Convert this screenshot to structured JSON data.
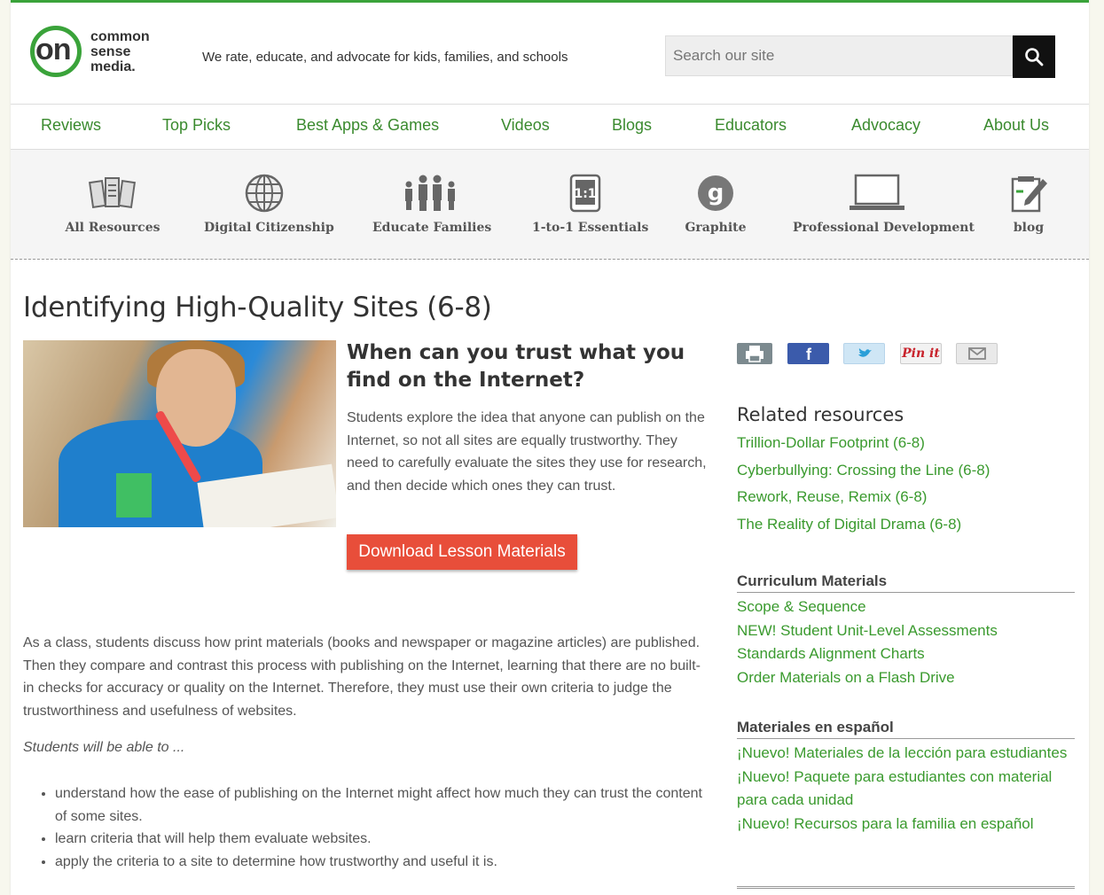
{
  "brand": {
    "logo_on": "on",
    "logo_lines": [
      "common",
      "sense",
      "media."
    ],
    "tagline": "We rate, educate, and advocate for kids, families, and schools"
  },
  "search": {
    "placeholder": "Search our site"
  },
  "main_nav": [
    "Reviews",
    "Top Picks",
    "Best Apps & Games",
    "Videos",
    "Blogs",
    "Educators",
    "Advocacy",
    "About Us"
  ],
  "sub_nav": [
    {
      "label": "All Resources",
      "icon": "stacked-papers-icon"
    },
    {
      "label": "Digital Citizenship",
      "icon": "globe-icon"
    },
    {
      "label": "Educate Families",
      "icon": "family-icon"
    },
    {
      "label": "1-to-1 Essentials",
      "icon": "one-to-one-icon"
    },
    {
      "label": "Graphite",
      "icon": "graphite-g-icon"
    },
    {
      "label": "Professional Development",
      "icon": "laptop-icon"
    },
    {
      "label": "blog",
      "icon": "notepad-pencil-icon"
    }
  ],
  "lesson": {
    "title": "Identifying High-Quality Sites (6-8)",
    "question": "When can you trust what you find on the Internet?",
    "description": "Students explore the idea that anyone can publish on the Internet, so not all sites are equally trustworthy. They need to carefully evaluate the sites they use for research, and then decide which ones they can trust.",
    "download_label": "Download Lesson Materials",
    "body": "As a class, students discuss how print materials (books and newspaper or magazine articles) are published. Then they compare and contrast this process with publishing on the Internet, learning that there are no built-in checks for accuracy or quality on the Internet. Therefore, they must use their own criteria to judge the trustworthiness and usefulness of websites.",
    "objectives_intro": "Students will be able to ...",
    "objectives": [
      "understand how the ease of publishing on the Internet might affect how much they can trust the content of some sites.",
      "learn criteria that will help them evaluate websites.",
      "apply the criteria to a site to determine how trustworthy and useful it is."
    ]
  },
  "share": {
    "pinterest_label": "Pin it",
    "colors": {
      "print": "#7c8a8f",
      "facebook": "#3b5bab",
      "twitter": "#cfe6f5",
      "pinterest": "#f2f2f2",
      "email": "#e9e9e9"
    }
  },
  "related": {
    "title": "Related resources",
    "items": [
      "Trillion-Dollar Footprint (6-8)",
      "Cyberbullying: Crossing the Line (6-8)",
      "Rework, Reuse, Remix (6-8)",
      "The Reality of Digital Drama (6-8)"
    ]
  },
  "curriculum": {
    "title": "Curriculum Materials",
    "items": [
      "Scope & Sequence",
      "NEW! Student Unit-Level Assessments",
      "Standards Alignment Charts",
      "Order Materials on a Flash Drive"
    ]
  },
  "espanol": {
    "title": "Materiales en español",
    "items": [
      "¡Nuevo! Materiales de la lección para estudiantes",
      "¡Nuevo! Paquete para estudiantes con material para cada unidad",
      "¡Nuevo! Recursos para la familia en español"
    ]
  },
  "colors": {
    "accent_green": "#3aa33a",
    "link_green": "#3a9a2e",
    "download_red": "#e84e3a"
  }
}
